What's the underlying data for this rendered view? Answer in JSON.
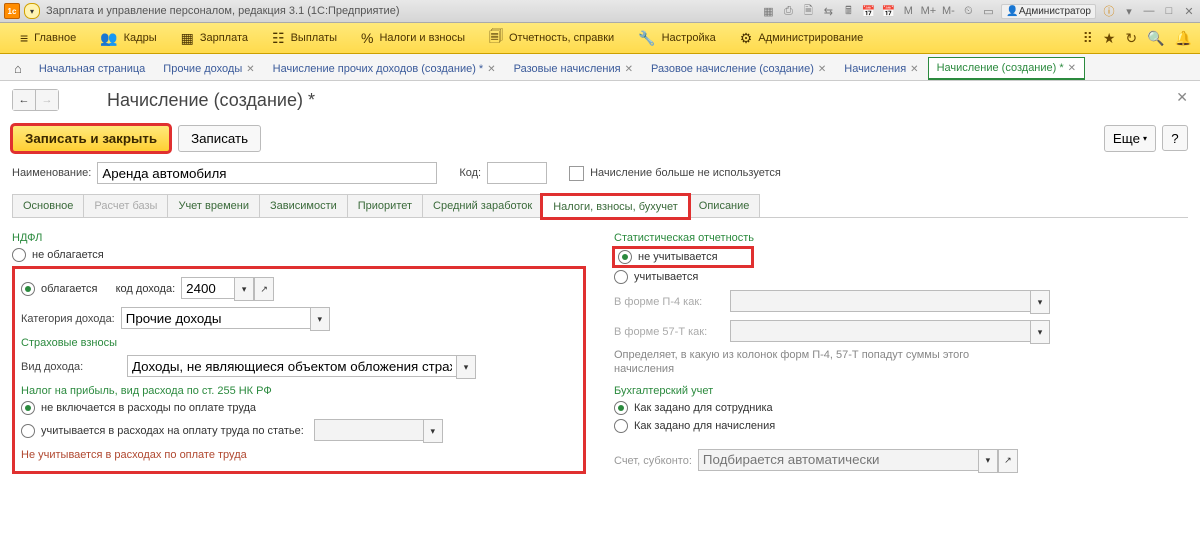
{
  "titlebar": {
    "app_title": "Зарплата и управление персоналом, редакция 3.1  (1С:Предприятие)",
    "user": "Администратор",
    "m_labels": [
      "M",
      "M+",
      "M-"
    ]
  },
  "mainmenu": {
    "items": [
      {
        "label": "Главное"
      },
      {
        "label": "Кадры"
      },
      {
        "label": "Зарплата"
      },
      {
        "label": "Выплаты"
      },
      {
        "label": "Налоги и взносы"
      },
      {
        "label": "Отчетность, справки"
      },
      {
        "label": "Настройка"
      },
      {
        "label": "Администрирование"
      }
    ]
  },
  "opentabs": [
    {
      "label": "Начальная страница",
      "closeable": false
    },
    {
      "label": "Прочие доходы",
      "closeable": true
    },
    {
      "label": "Начисление прочих доходов (создание) *",
      "closeable": true
    },
    {
      "label": "Разовые начисления",
      "closeable": true
    },
    {
      "label": "Разовое начисление (создание)",
      "closeable": true
    },
    {
      "label": "Начисления",
      "closeable": true
    },
    {
      "label": "Начисление (создание) *",
      "closeable": true,
      "active": true
    }
  ],
  "page": {
    "title": "Начисление (создание) *",
    "save_close": "Записать и закрыть",
    "save": "Записать",
    "more": "Еще",
    "help": "?",
    "name_label": "Наименование:",
    "name_value": "Аренда автомобиля",
    "code_label": "Код:",
    "code_value": "",
    "disabled_label": "Начисление больше не используется"
  },
  "subtabs": [
    {
      "label": "Основное"
    },
    {
      "label": "Расчет базы",
      "disabled": true
    },
    {
      "label": "Учет времени"
    },
    {
      "label": "Зависимости"
    },
    {
      "label": "Приоритет"
    },
    {
      "label": "Средний заработок"
    },
    {
      "label": "Налоги, взносы, бухучет",
      "active": true
    },
    {
      "label": "Описание"
    }
  ],
  "left": {
    "ndfl_h": "НДФЛ",
    "ndfl_opt1": "не облагается",
    "ndfl_opt2": "облагается",
    "code_label": "код дохода:",
    "code_value": "2400",
    "cat_label": "Категория дохода:",
    "cat_value": "Прочие доходы",
    "ins_h": "Страховые взносы",
    "ins_kind_label": "Вид дохода:",
    "ins_kind_value": "Доходы, не являющиеся объектом обложения страховыми в",
    "profit_h": "Налог на прибыль, вид расхода по ст. 255 НК РФ",
    "profit_opt1": "не включается в расходы по оплате труда",
    "profit_opt2": "учитывается в расходах на оплату труда по статье:",
    "profit_note": "Не учитывается в расходах по оплате труда"
  },
  "right": {
    "stat_h": "Статистическая отчетность",
    "stat_opt1": "не учитывается",
    "stat_opt2": "учитывается",
    "p4_label": "В форме П-4 как:",
    "p57_label": "В форме 57-Т как:",
    "desc": "Определяет, в какую из колонок форм П-4, 57-Т попадут суммы этого начисления",
    "acct_h": "Бухгалтерский учет",
    "acct_opt1": "Как задано для сотрудника",
    "acct_opt2": "Как задано для начисления",
    "acct_label": "Счет, субконто:",
    "acct_placeholder": "Подбирается автоматически"
  }
}
